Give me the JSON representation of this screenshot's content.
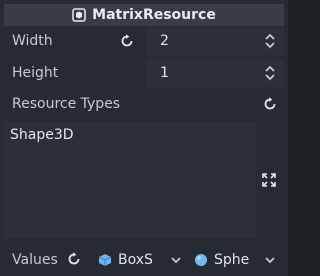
{
  "header": {
    "title": "MatrixResource",
    "icon": "resource-icon"
  },
  "width": {
    "label": "Width",
    "value": "2"
  },
  "height": {
    "label": "Height",
    "value": "1"
  },
  "resource_types": {
    "label": "Resource Types",
    "items": [
      "Shape3D"
    ]
  },
  "values": {
    "label": "Values",
    "picks": [
      {
        "text": "BoxS",
        "icon": "box-shape-icon",
        "color": "#6fb3f0"
      },
      {
        "text": "Sphe",
        "icon": "sphere-shape-icon",
        "color": "#73b8f5"
      }
    ]
  },
  "colors": {
    "panel": "#262a31",
    "header": "#373c47",
    "field": "#2b2f37",
    "text": "#d3d7de"
  }
}
